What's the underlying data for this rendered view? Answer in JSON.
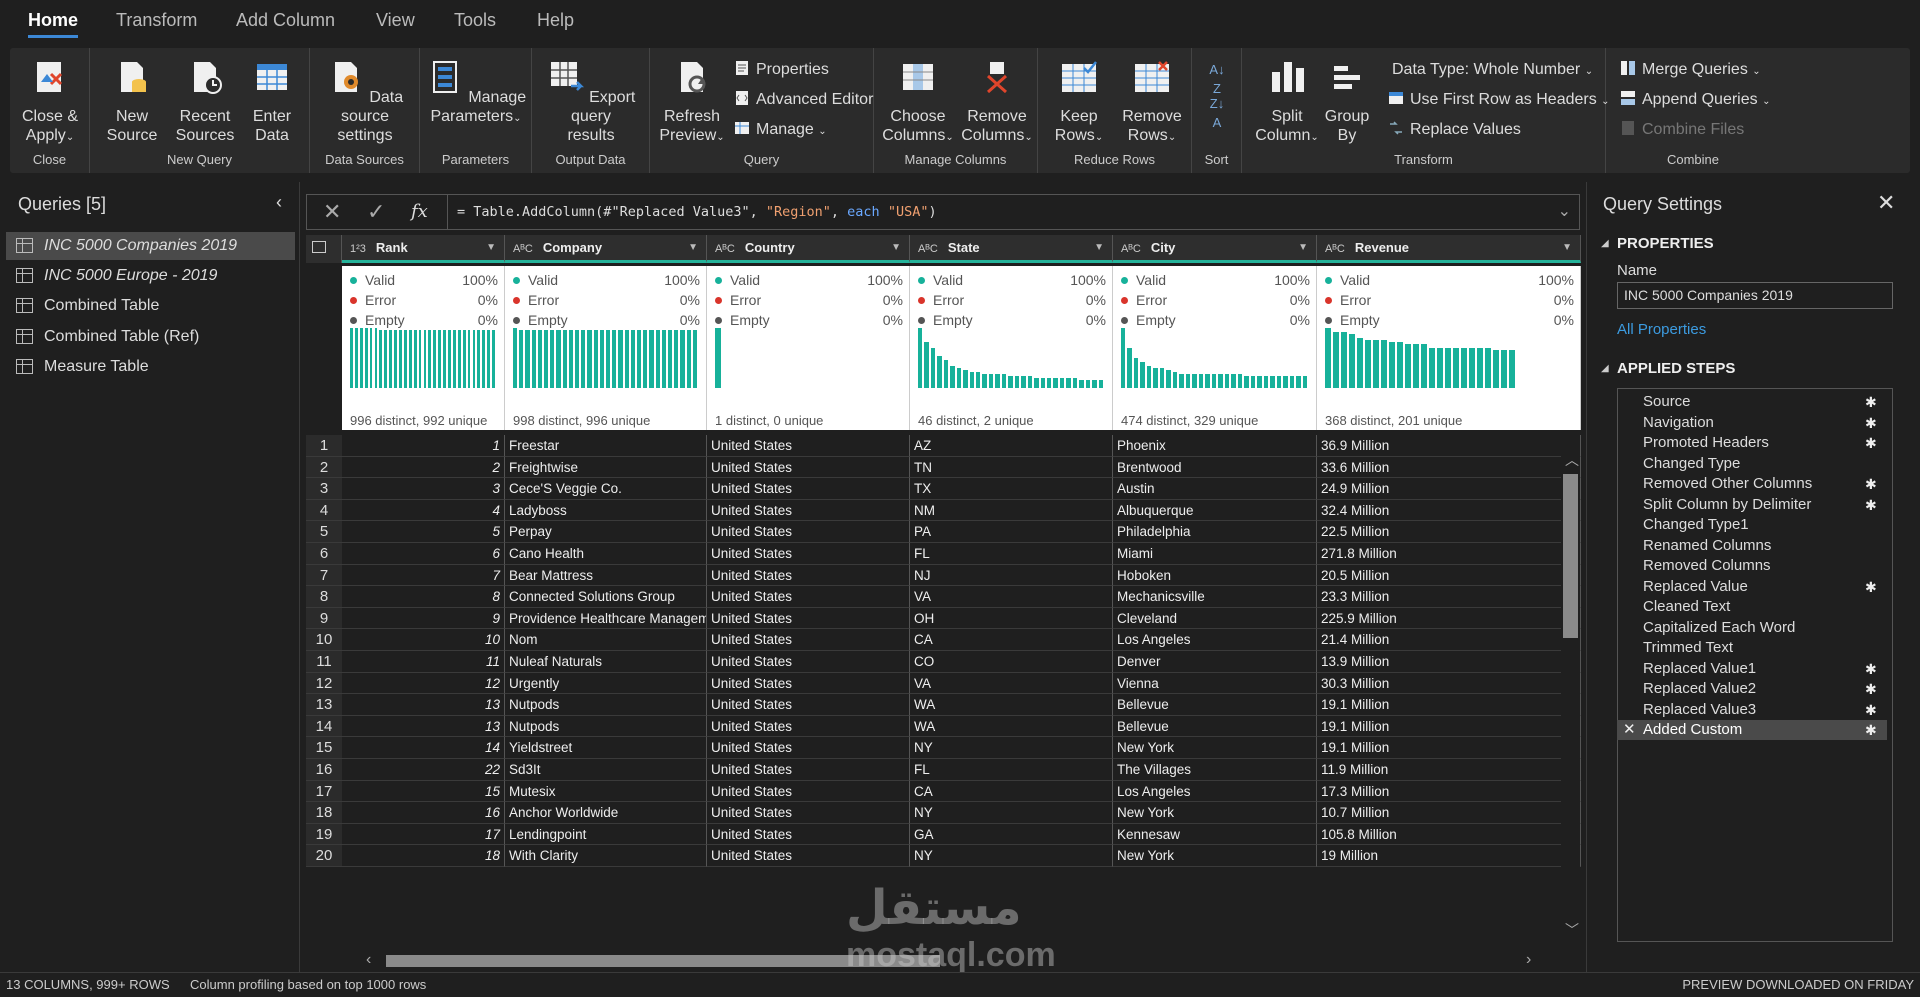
{
  "menu": {
    "tabs": [
      "Home",
      "Transform",
      "Add Column",
      "View",
      "Tools",
      "Help"
    ]
  },
  "ribbon": {
    "close": {
      "btn": "Close &\nApply",
      "group": "Close"
    },
    "new_query": {
      "new_source": "New\nSource",
      "recent_sources": "Recent\nSources",
      "enter_data": "Enter\nData",
      "group": "New Query"
    },
    "data_sources": {
      "btn": "Data source\nsettings",
      "group": "Data Sources"
    },
    "parameters": {
      "btn": "Manage\nParameters",
      "group": "Parameters"
    },
    "output": {
      "btn": "Export query\nresults",
      "group": "Output Data"
    },
    "query": {
      "refresh": "Refresh\nPreview",
      "properties": "Properties",
      "advanced_editor": "Advanced Editor",
      "manage": "Manage",
      "group": "Query"
    },
    "manage_columns": {
      "choose": "Choose\nColumns",
      "remove": "Remove\nColumns",
      "group": "Manage Columns"
    },
    "reduce_rows": {
      "keep": "Keep\nRows",
      "remove": "Remove\nRows",
      "group": "Reduce Rows"
    },
    "sort": {
      "group": "Sort"
    },
    "transform": {
      "split": "Split\nColumn",
      "group_by": "Group\nBy",
      "data_type": "Data Type: Whole Number",
      "first_row": "Use First Row as Headers",
      "replace": "Replace Values",
      "group": "Transform"
    },
    "combine": {
      "merge": "Merge Queries",
      "append": "Append Queries",
      "combine_files": "Combine Files",
      "group": "Combine"
    }
  },
  "queries": {
    "title": "Queries [5]",
    "items": [
      "INC 5000 Companies 2019",
      "INC 5000 Europe - 2019",
      "Combined Table",
      "Combined Table (Ref)",
      "Measure Table"
    ]
  },
  "formula": {
    "prefix": "= Table.AddColumn(#",
    "p1": "\"Replaced Value3\"",
    "p2": ", ",
    "p3": "\"Region\"",
    "p4": ", ",
    "kw": "each",
    "p5": " ",
    "p6": "\"USA\"",
    "p7": ")"
  },
  "columns": [
    {
      "type": "1²3",
      "name": "Rank",
      "valid": "100%",
      "error": "0%",
      "empty": "0%",
      "foot": "996 distinct, 992 unique"
    },
    {
      "type": "AᴮC",
      "name": "Company",
      "valid": "100%",
      "error": "0%",
      "empty": "0%",
      "foot": "998 distinct, 996 unique"
    },
    {
      "type": "AᴮC",
      "name": "Country",
      "valid": "100%",
      "error": "0%",
      "empty": "0%",
      "foot": "1 distinct, 0 unique"
    },
    {
      "type": "AᴮC",
      "name": "State",
      "valid": "100%",
      "error": "0%",
      "empty": "0%",
      "foot": "46 distinct, 2 unique"
    },
    {
      "type": "AᴮC",
      "name": "City",
      "valid": "100%",
      "error": "0%",
      "empty": "0%",
      "foot": "474 distinct, 329 unique"
    },
    {
      "type": "AᴮC",
      "name": "Revenue",
      "valid": "100%",
      "error": "0%",
      "empty": "0%",
      "foot": "368 distinct, 201 unique"
    }
  ],
  "profile_labels": {
    "valid": "Valid",
    "error": "Error",
    "empty": "Empty"
  },
  "rows": [
    [
      "1",
      "1",
      "Freestar",
      "United States",
      "AZ",
      "Phoenix",
      "36.9 Million"
    ],
    [
      "2",
      "2",
      "Freightwise",
      "United States",
      "TN",
      "Brentwood",
      "33.6 Million"
    ],
    [
      "3",
      "3",
      "Cece'S Veggie Co.",
      "United States",
      "TX",
      "Austin",
      "24.9 Million"
    ],
    [
      "4",
      "4",
      "Ladyboss",
      "United States",
      "NM",
      "Albuquerque",
      "32.4 Million"
    ],
    [
      "5",
      "5",
      "Perpay",
      "United States",
      "PA",
      "Philadelphia",
      "22.5 Million"
    ],
    [
      "6",
      "6",
      "Cano Health",
      "United States",
      "FL",
      "Miami",
      "271.8 Million"
    ],
    [
      "7",
      "7",
      "Bear Mattress",
      "United States",
      "NJ",
      "Hoboken",
      "20.5 Million"
    ],
    [
      "8",
      "8",
      "Connected Solutions Group",
      "United States",
      "VA",
      "Mechanicsville",
      "23.3 Million"
    ],
    [
      "9",
      "9",
      "Providence Healthcare Management",
      "United States",
      "OH",
      "Cleveland",
      "225.9 Million"
    ],
    [
      "10",
      "10",
      "Nom",
      "United States",
      "CA",
      "Los Angeles",
      "21.4 Million"
    ],
    [
      "11",
      "11",
      "Nuleaf Naturals",
      "United States",
      "CO",
      "Denver",
      "13.9 Million"
    ],
    [
      "12",
      "12",
      "Urgently",
      "United States",
      "VA",
      "Vienna",
      "30.3 Million"
    ],
    [
      "13",
      "13",
      "Nutpods",
      "United States",
      "WA",
      "Bellevue",
      "19.1 Million"
    ],
    [
      "14",
      "13",
      "Nutpods",
      "United States",
      "WA",
      "Bellevue",
      "19.1 Million"
    ],
    [
      "15",
      "14",
      "Yieldstreet",
      "United States",
      "NY",
      "New York",
      "19.1 Million"
    ],
    [
      "16",
      "22",
      "Sd3It",
      "United States",
      "FL",
      "The Villages",
      "11.9 Million"
    ],
    [
      "17",
      "15",
      "Mutesix",
      "United States",
      "CA",
      "Los Angeles",
      "17.3 Million"
    ],
    [
      "18",
      "16",
      "Anchor Worldwide",
      "United States",
      "NY",
      "New York",
      "10.7 Million"
    ],
    [
      "19",
      "17",
      "Lendingpoint",
      "United States",
      "GA",
      "Kennesaw",
      "105.8 Million"
    ],
    [
      "20",
      "18",
      "With Clarity",
      "United States",
      "NY",
      "New York",
      "19 Million"
    ]
  ],
  "settings": {
    "title": "Query Settings",
    "properties": "PROPERTIES",
    "name_label": "Name",
    "name_value": "INC 5000 Companies 2019",
    "all_properties": "All Properties",
    "applied_steps": "APPLIED STEPS",
    "steps": [
      {
        "label": "Source",
        "gear": true
      },
      {
        "label": "Navigation",
        "gear": true
      },
      {
        "label": "Promoted Headers",
        "gear": true
      },
      {
        "label": "Changed Type",
        "gear": false
      },
      {
        "label": "Removed Other Columns",
        "gear": true
      },
      {
        "label": "Split Column by Delimiter",
        "gear": true
      },
      {
        "label": "Changed Type1",
        "gear": false
      },
      {
        "label": "Renamed Columns",
        "gear": false
      },
      {
        "label": "Removed Columns",
        "gear": false
      },
      {
        "label": "Replaced Value",
        "gear": true
      },
      {
        "label": "Cleaned Text",
        "gear": false
      },
      {
        "label": "Capitalized Each Word",
        "gear": false
      },
      {
        "label": "Trimmed Text",
        "gear": false
      },
      {
        "label": "Replaced Value1",
        "gear": true
      },
      {
        "label": "Replaced Value2",
        "gear": true
      },
      {
        "label": "Replaced Value3",
        "gear": true
      },
      {
        "label": "Added Custom",
        "gear": true
      }
    ]
  },
  "status": {
    "left1": "13 COLUMNS, 999+ ROWS",
    "left2": "Column profiling based on top 1000 rows",
    "right": "PREVIEW DOWNLOADED ON FRIDAY"
  },
  "watermark": {
    "arabic": "مستقل",
    "latin": "mostaql.com"
  },
  "colors": {
    "accent": "#3c88d6",
    "teal": "#17b19a",
    "valid": "#17b19a",
    "error": "#d9342b",
    "empty": "#555555",
    "link": "#3c9be0"
  }
}
